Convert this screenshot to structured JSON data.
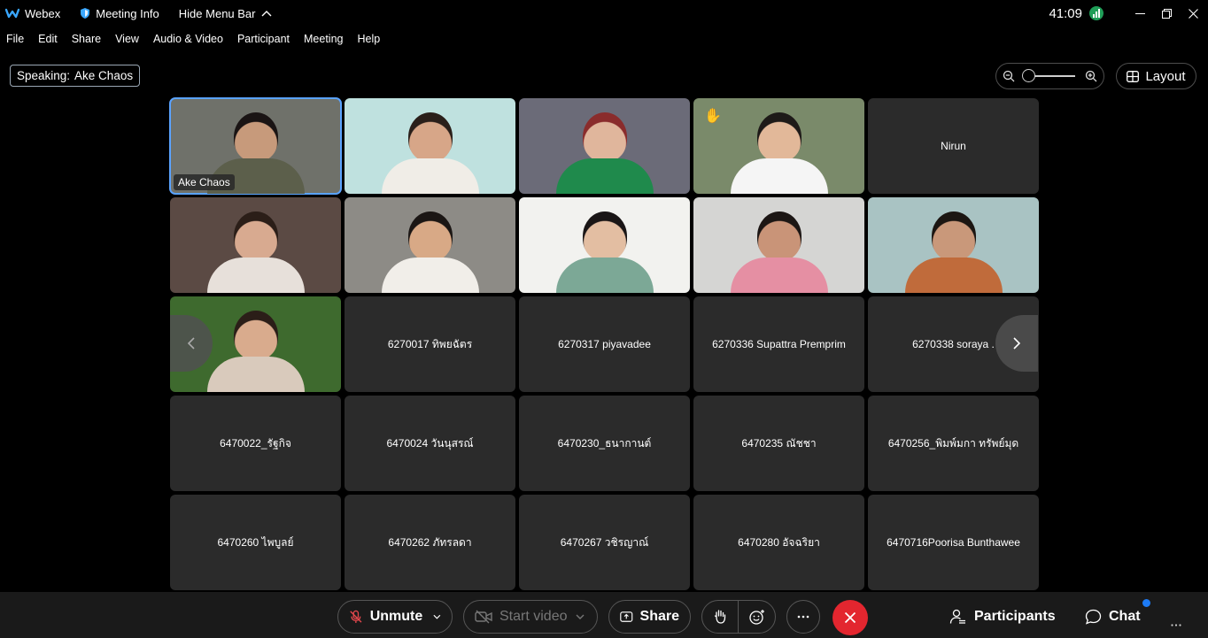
{
  "titlebar": {
    "app_name": "Webex",
    "meeting_info": "Meeting Info",
    "hide_menu": "Hide Menu Bar",
    "timer": "41:09"
  },
  "menu": [
    "File",
    "Edit",
    "Share",
    "View",
    "Audio & Video",
    "Participant",
    "Meeting",
    "Help"
  ],
  "speaking": {
    "prefix": "Speaking:",
    "name": "Ake Chaos"
  },
  "layout_label": "Layout",
  "zoom_level": 0.0,
  "video_tiles": [
    {
      "label": "Ake Chaos",
      "bg": "#6f716a",
      "skin": "#c79a7b",
      "shirt": "#5c5f4b",
      "hair": "#1a1414"
    },
    {
      "label": "",
      "bg": "#bfe1df",
      "skin": "#d7a688",
      "shirt": "#f0ede7",
      "hair": "#2a1f1a"
    },
    {
      "label": "",
      "bg": "#6b6b78",
      "skin": "#e0b69c",
      "shirt": "#1f8a4c",
      "hair": "#8a2c2c"
    },
    {
      "label": "",
      "bg": "#7a8a6a",
      "skin": "#e2b899",
      "shirt": "#f5f5f5",
      "hair": "#1e1a18"
    },
    {
      "label": "",
      "bg": "#5b4a44",
      "skin": "#d8aa90",
      "shirt": "#e7e0da",
      "hair": "#2b1e18"
    },
    {
      "label": "",
      "bg": "#8d8b86",
      "skin": "#d8a986",
      "shirt": "#f1eee9",
      "hair": "#1b1614"
    },
    {
      "label": "",
      "bg": "#f2f2ef",
      "skin": "#e3bea2",
      "shirt": "#7ca896",
      "hair": "#1a1616"
    },
    {
      "label": "",
      "bg": "#d5d5d3",
      "skin": "#c99478",
      "shirt": "#e58fa3",
      "hair": "#1c1614"
    },
    {
      "label": "",
      "bg": "#a9c3c3",
      "skin": "#c9987a",
      "shirt": "#c06b3b",
      "hair": "#1c1612"
    },
    {
      "label": "",
      "bg": "#3e6a2e",
      "skin": "#d9ab8d",
      "shirt": "#d9cabc",
      "hair": "#2b1e18"
    }
  ],
  "raised_hand_tile": 3,
  "name_tiles": [
    "Nirun",
    "6270017 ทิพยฉัตร",
    "6270317 piyavadee",
    "6270336 Supattra Premprim",
    "6270338 soraya .",
    "6470022_รัฐกิจ",
    "6470024 วันนุสรณ์",
    "6470230_ธนากานต์",
    "6470235 ณัชชา",
    "6470256_พิมพ์มกา ทรัพย์มุด",
    "6470260 ไพบูลย์",
    "6470262 ภัทรลดา",
    "6470267 วชิรญาณ์",
    "6470280 อัจฉริยา",
    "6470716Poorisa Bunthawee"
  ],
  "controls": {
    "unmute": "Unmute",
    "start_video": "Start video",
    "share": "Share",
    "participants": "Participants",
    "chat": "Chat"
  },
  "colors": {
    "end_call": "#e3262f",
    "active_outline": "#5aa3ff",
    "chat_badge": "#1d7bf5"
  }
}
